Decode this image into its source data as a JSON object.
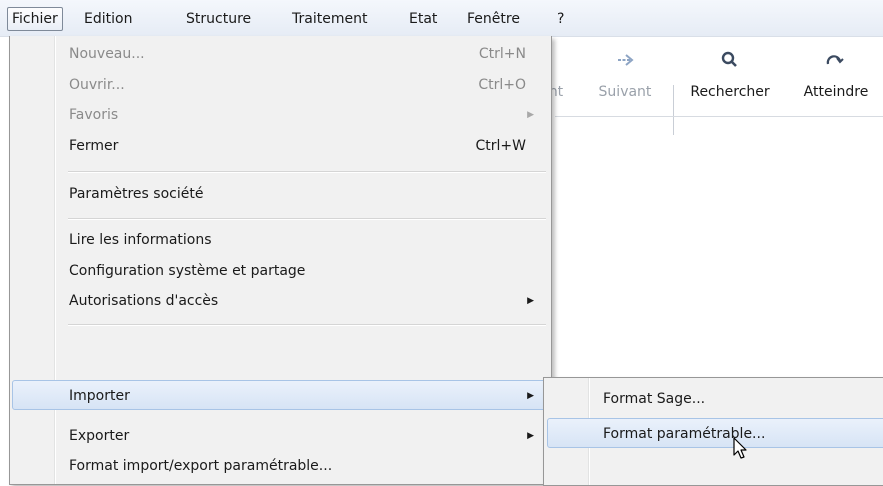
{
  "menubar": {
    "items": [
      "Fichier",
      "Edition",
      "Structure",
      "Traitement",
      "Etat",
      "Fenêtre",
      "?"
    ]
  },
  "toolbar": {
    "prev_label": "nt",
    "next_label": "Suivant",
    "search_label": "Rechercher",
    "goto_label": "Atteindre",
    "next_icon": "arrow-right-icon",
    "search_icon": "search-icon",
    "goto_icon": "redo-icon"
  },
  "file_menu": {
    "items": [
      {
        "label": "Nouveau...",
        "shortcut": "Ctrl+N",
        "disabled": true
      },
      {
        "label": "Ouvrir...",
        "shortcut": "Ctrl+O",
        "disabled": true
      },
      {
        "label": "Favoris",
        "submenu": true,
        "disabled": true
      },
      {
        "label": "Fermer",
        "shortcut": "Ctrl+W"
      },
      {
        "label": "Paramètres société"
      },
      {
        "label": "Lire les informations"
      },
      {
        "label": "Configuration système et partage"
      },
      {
        "label": "Autorisations d'accès",
        "submenu": true
      },
      {
        "label": "Importer",
        "submenu": true,
        "highlighted": true
      },
      {
        "label": "Exporter",
        "submenu": true
      },
      {
        "label": "Format import/export paramétrable..."
      }
    ]
  },
  "import_submenu": {
    "items": [
      {
        "label": "Format Sage..."
      },
      {
        "label": "Format paramétrable...",
        "highlighted": true
      }
    ]
  },
  "colors": {
    "menu_bg": "#f1f1f1",
    "highlight_border": "#a8c4e6",
    "highlight_bg": "#dbe6f6",
    "disabled_text": "#8a8a8a"
  }
}
